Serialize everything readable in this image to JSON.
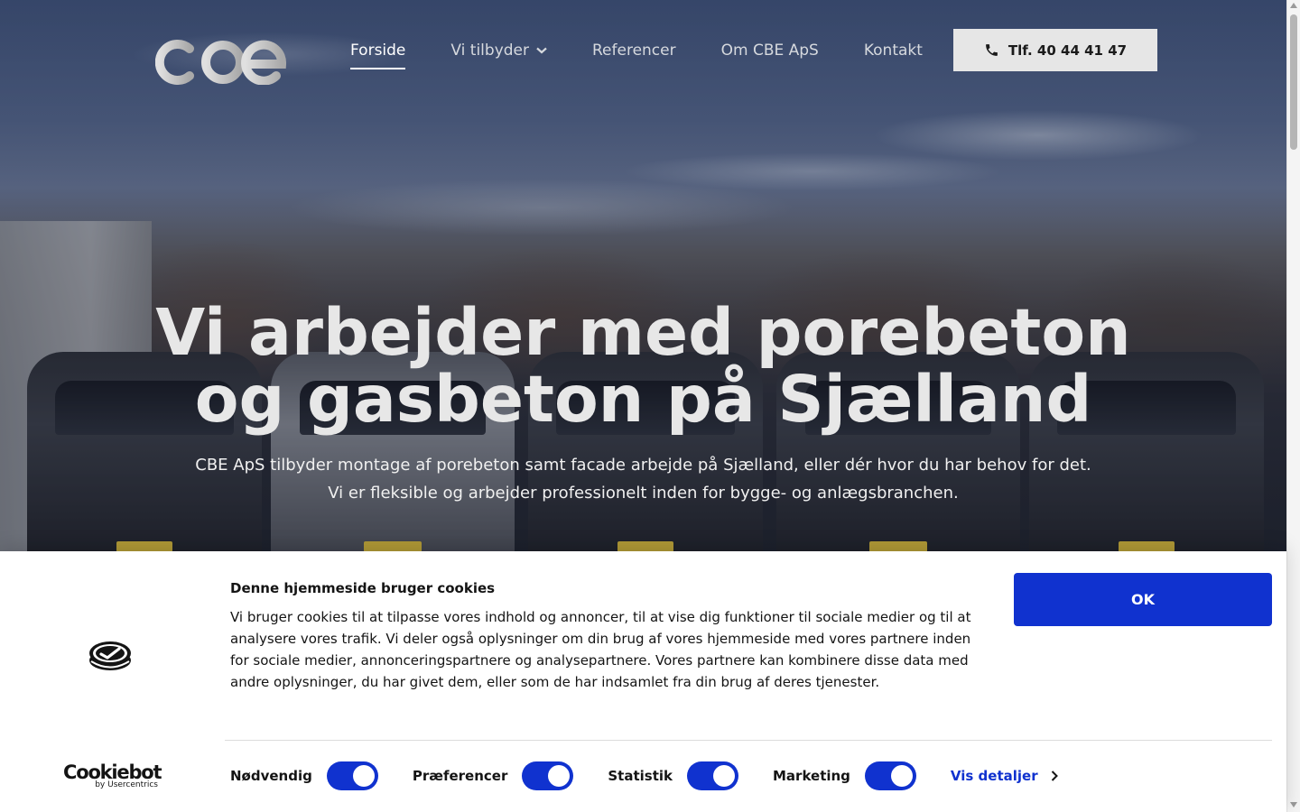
{
  "header": {
    "logo_text": "cbe",
    "nav": [
      {
        "label": "Forside",
        "active": true
      },
      {
        "label": "Vi tilbyder",
        "has_dropdown": true
      },
      {
        "label": "Referencer"
      },
      {
        "label": "Om CBE ApS"
      },
      {
        "label": "Kontakt"
      }
    ],
    "phone_label": "Tlf. 40 44 41 47",
    "phone_icon": "phone-icon"
  },
  "hero": {
    "title_line1": "Vi arbejder med porebeton",
    "title_line2": "og gasbeton på Sjælland",
    "subtitle_line1": "CBE ApS tilbyder montage af porebeton samt facade arbejde på Sjælland, eller dér hvor du har behov for det.",
    "subtitle_line2": "Vi er fleksible og arbejder professionelt inden for bygge- og anlægsbranchen."
  },
  "cookie_banner": {
    "title": "Denne hjemmeside bruger cookies",
    "text": "Vi bruger cookies til at tilpasse vores indhold og annoncer, til at vise dig funktioner til sociale medier og til at analysere vores trafik. Vi deler også oplysninger om din brug af vores hjemmeside med vores partnere inden for sociale medier, annonceringspartnere og analysepartnere. Vores partnere kan kombinere disse data med andre oplysninger, du har givet dem, eller som de har indsamlet fra din brug af deres tjenester.",
    "ok_label": "OK",
    "brand": "Cookiebot",
    "brand_sub": "by Usercentrics",
    "toggles": [
      {
        "label": "Nødvendig",
        "on": true
      },
      {
        "label": "Præferencer",
        "on": true
      },
      {
        "label": "Statistik",
        "on": true
      },
      {
        "label": "Marketing",
        "on": true
      }
    ],
    "details_label": "Vis detaljer"
  },
  "colors": {
    "accent": "#1032cf",
    "phone_button_bg": "#e6e6e6"
  }
}
